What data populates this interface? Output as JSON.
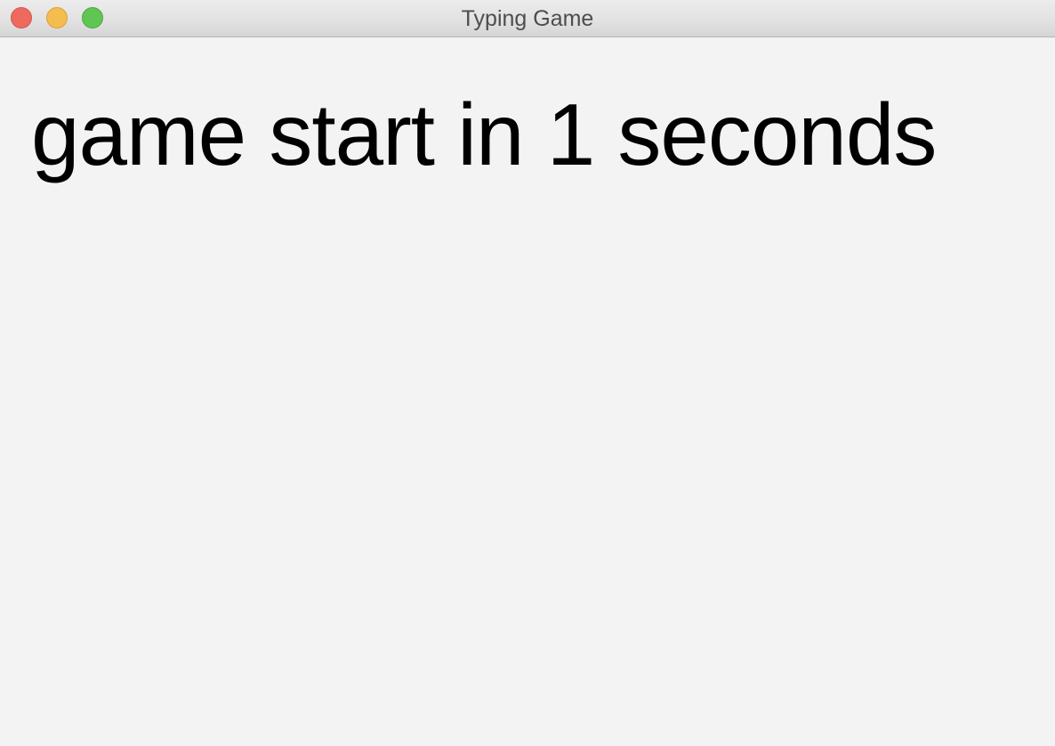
{
  "window": {
    "title": "Typing Game",
    "controls": {
      "close": "close-button",
      "minimize": "minimize-button",
      "zoom": "zoom-button"
    }
  },
  "main": {
    "countdown_text": "game start in 1 seconds"
  },
  "colors": {
    "background": "#f3f3f3",
    "text": "#000000",
    "close": "#ee6a5f",
    "minimize": "#f5bd4f",
    "zoom": "#61c554"
  }
}
